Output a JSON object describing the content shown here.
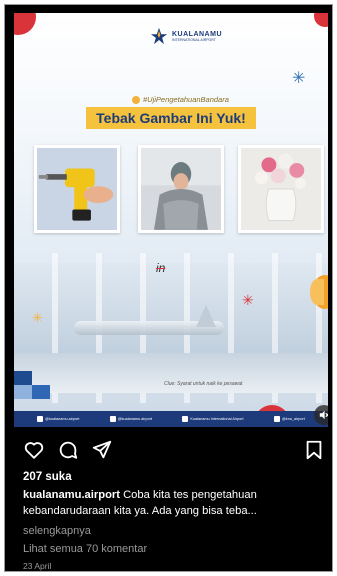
{
  "post_image": {
    "brand_name": "KUALANAMU",
    "brand_sub": "INTERNATIONAL AIRPORT",
    "hashtag": "#UjiPengetahuanBandara",
    "headline": "Tebak Gambar Ini Yuk!",
    "answer_hint": "in",
    "clue": "Clue: Syarat untuk naik ke pesawat",
    "footer_handles": [
      "@kualanamu.airport",
      "@kualanamu.airport",
      "Kualanamu International Airport",
      "@kno_airport"
    ],
    "pictures": [
      "drill",
      "person-cold",
      "flower-vase"
    ],
    "accent_colors": {
      "navy": "#1d3b7a",
      "yellow": "#f5c23d",
      "red": "#d8343a",
      "orange": "#f2a22a"
    }
  },
  "controls": {
    "mute_icon": "speaker-muted-icon"
  },
  "actions": {
    "icons": [
      "heart-icon",
      "comment-icon",
      "share-icon",
      "bookmark-icon"
    ]
  },
  "post_info": {
    "likes": "207 suka",
    "username": "kualanamu.airport",
    "caption": " Coba kita tes pengetahuan kebandarudaraan kita ya. Ada yang bisa teba...",
    "more_label": "selengkapnya",
    "comments_link": "Lihat semua 70 komentar",
    "date": "23 April"
  }
}
